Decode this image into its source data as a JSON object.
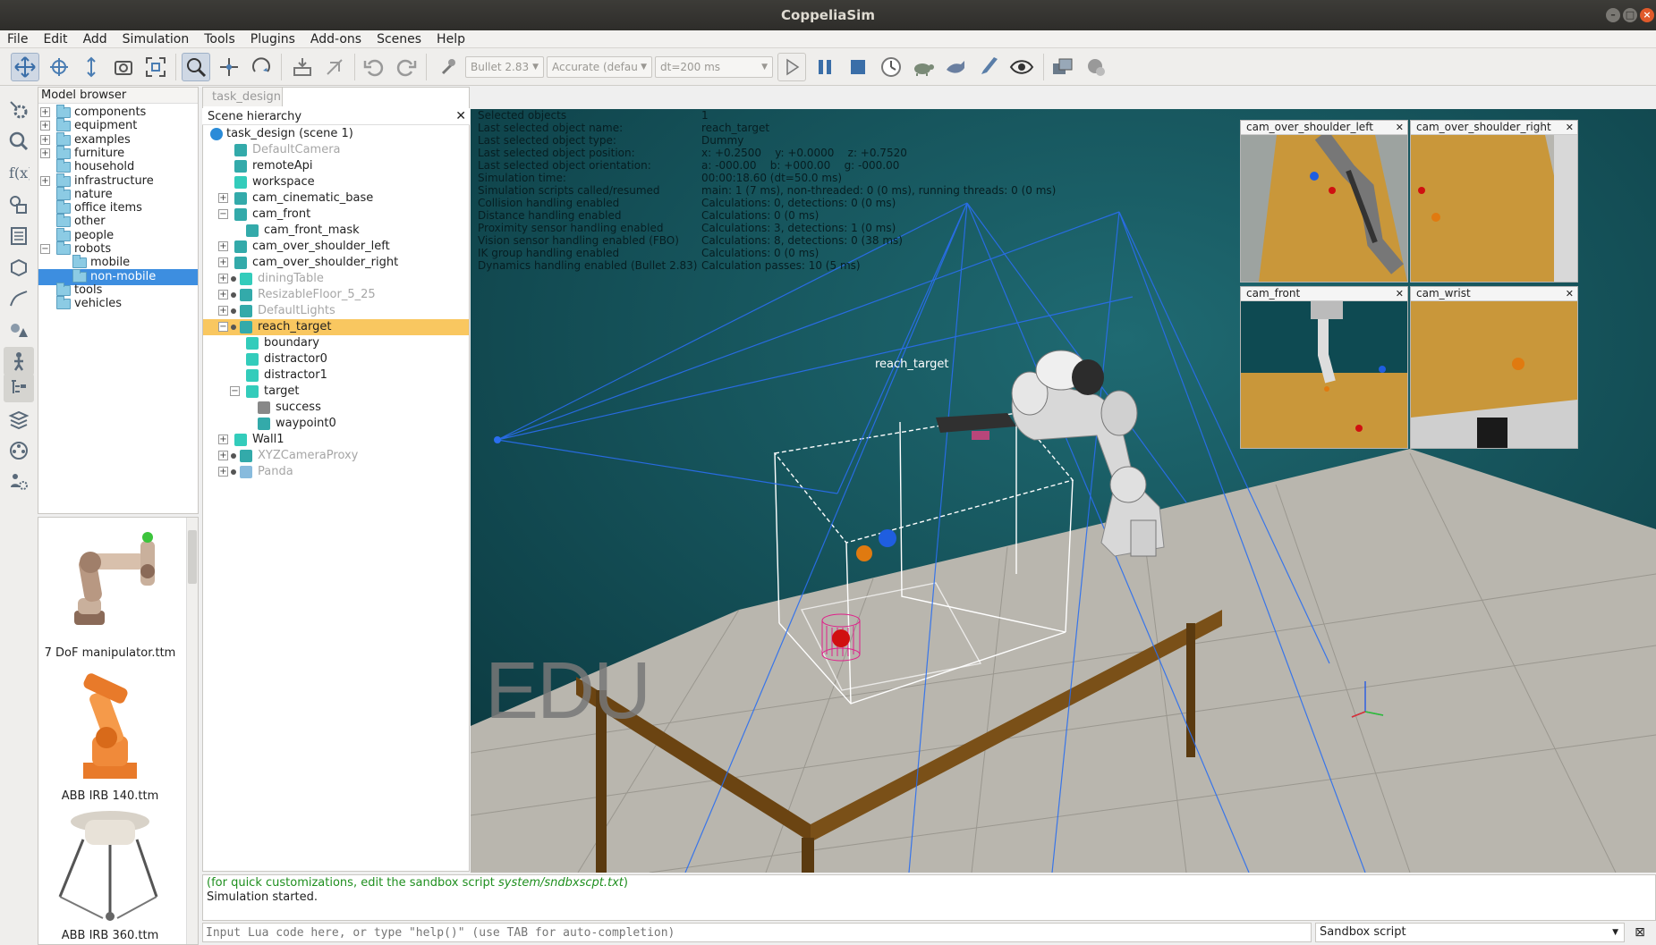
{
  "window": {
    "title": "CoppeliaSim"
  },
  "menu": [
    "File",
    "Edit",
    "Add",
    "Simulation",
    "Tools",
    "Plugins",
    "Add-ons",
    "Scenes",
    "Help"
  ],
  "toolbar": {
    "engine": "Bullet 2.83",
    "accuracy": "Accurate (defau",
    "timestep": "dt=200 ms"
  },
  "model_browser": {
    "title": "Model browser",
    "items": [
      {
        "label": "components",
        "expander": "+"
      },
      {
        "label": "equipment",
        "expander": "+"
      },
      {
        "label": "examples",
        "expander": "+"
      },
      {
        "label": "furniture",
        "expander": "+"
      },
      {
        "label": "household",
        "expander": ""
      },
      {
        "label": "infrastructure",
        "expander": "+"
      },
      {
        "label": "nature",
        "expander": ""
      },
      {
        "label": "office items",
        "expander": ""
      },
      {
        "label": "other",
        "expander": ""
      },
      {
        "label": "people",
        "expander": ""
      },
      {
        "label": "robots",
        "expander": "−"
      },
      {
        "label": "mobile",
        "expander": ""
      },
      {
        "label": "non-mobile",
        "expander": ""
      },
      {
        "label": "tools",
        "expander": ""
      },
      {
        "label": "vehicles",
        "expander": ""
      }
    ],
    "thumbnails": [
      "7 DoF manipulator.ttm",
      "ABB IRB 140.ttm",
      "ABB IRB 360.ttm"
    ]
  },
  "scene": {
    "tab": "task_design",
    "hierarchy_title": "Scene hierarchy",
    "items": [
      {
        "label": "task_design (scene 1)",
        "muted": false
      },
      {
        "label": "DefaultCamera",
        "muted": true
      },
      {
        "label": "remoteApi",
        "muted": false
      },
      {
        "label": "workspace",
        "muted": false
      },
      {
        "label": "cam_cinematic_base",
        "muted": false
      },
      {
        "label": "cam_front",
        "muted": false
      },
      {
        "label": "cam_front_mask",
        "muted": false
      },
      {
        "label": "cam_over_shoulder_left",
        "muted": false
      },
      {
        "label": "cam_over_shoulder_right",
        "muted": false
      },
      {
        "label": "diningTable",
        "muted": true
      },
      {
        "label": "ResizableFloor_5_25",
        "muted": true
      },
      {
        "label": "DefaultLights",
        "muted": true
      },
      {
        "label": "reach_target",
        "muted": false
      },
      {
        "label": "boundary",
        "muted": false
      },
      {
        "label": "distractor0",
        "muted": false
      },
      {
        "label": "distractor1",
        "muted": false
      },
      {
        "label": "target",
        "muted": false
      },
      {
        "label": "success",
        "muted": false
      },
      {
        "label": "waypoint0",
        "muted": false
      },
      {
        "label": "Wall1",
        "muted": false
      },
      {
        "label": "XYZCameraProxy",
        "muted": true
      },
      {
        "label": "Panda",
        "muted": true
      }
    ]
  },
  "info": {
    "labels": [
      "Selected objects",
      "Last selected object name:",
      "Last selected object type:",
      "Last selected object position:",
      "Last selected object orientation:",
      "Simulation time:",
      "Simulation scripts called/resumed",
      "Collision handling enabled",
      "Distance handling enabled",
      "Proximity sensor handling enabled",
      "Vision sensor handling enabled (FBO)",
      "IK group handling enabled",
      "Dynamics handling enabled (Bullet 2.83)"
    ],
    "values": [
      "1",
      "reach_target",
      "Dummy",
      "x: +0.2500    y: +0.0000    z: +0.7520",
      "a: -000.00    b: +000.00    g: -000.00",
      "00:00:18.60 (dt=50.0 ms)",
      "main: 1 (7 ms), non-threaded: 0 (0 ms), running threads: 0 (0 ms)",
      "Calculations: 0, detections: 0 (0 ms)",
      "Calculations: 0 (0 ms)",
      "Calculations: 3, detections: 1 (0 ms)",
      "Calculations: 8, detections: 0 (38 ms)",
      "Calculations: 0 (0 ms)",
      "Calculation passes: 10 (5 ms)"
    ]
  },
  "views": {
    "cam_over_shoulder_left": "cam_over_shoulder_left",
    "cam_over_shoulder_right": "cam_over_shoulder_right",
    "cam_front": "cam_front",
    "cam_wrist": "cam_wrist"
  },
  "viewport": {
    "object_label": "reach_target",
    "watermark": "EDU"
  },
  "console": {
    "hint_prefix": "(for quick customizations, edit the sandbox script ",
    "hint_path": "system/sndbxscpt.txt",
    "hint_suffix": ")",
    "message": "Simulation started.",
    "input_placeholder": "Input Lua code here, or type \"help()\" (use TAB for auto-completion)",
    "script_selector": "Sandbox script"
  },
  "colors": {
    "selection": "#f9c760",
    "hint_green": "#1f8f1f",
    "viewport_bg": "#0d3e45"
  }
}
